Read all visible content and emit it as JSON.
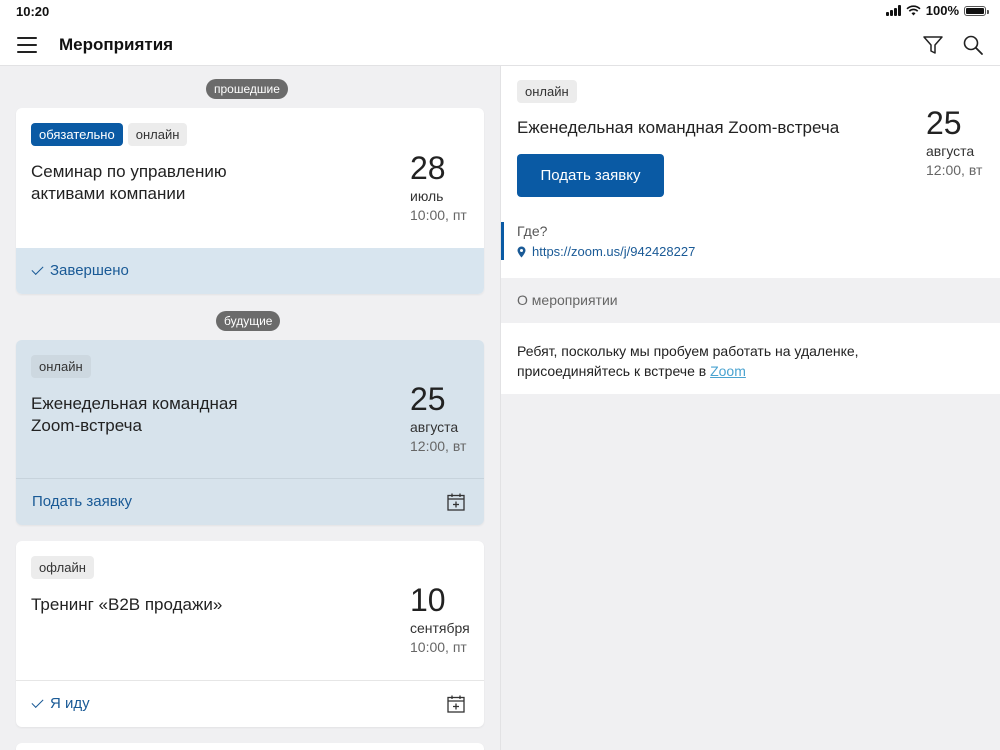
{
  "status_bar": {
    "time": "10:20",
    "battery": "100%"
  },
  "nav": {
    "title": "Мероприятия"
  },
  "list": {
    "past_label": "прошедшие",
    "future_label": "будущие",
    "events": [
      {
        "tags": [
          "обязательно",
          "онлайн"
        ],
        "title": "Семинар по управлению активами компании",
        "day": "28",
        "month": "июль",
        "time": "10:00, пт",
        "footer": "Завершено"
      },
      {
        "tags": [
          "онлайн"
        ],
        "title": "Еженедельная командная Zoom-встреча",
        "day": "25",
        "month": "августа",
        "time": "12:00, вт",
        "footer": "Подать заявку"
      },
      {
        "tags": [
          "офлайн"
        ],
        "title": "Тренинг «B2B продажи»",
        "day": "10",
        "month": "сентября",
        "time": "10:00, пт",
        "footer": "Я иду"
      }
    ]
  },
  "detail": {
    "tag": "онлайн",
    "title": "Еженедельная командная Zoom-встреча",
    "apply_label": "Подать заявку",
    "day": "25",
    "month": "августа",
    "time": "12:00, вт",
    "where_label": "Где?",
    "where_link": "https://zoom.us/j/942428227",
    "about_label": "О мероприятии",
    "about_text_1": "Ребят, поскольку мы пробуем работать на удаленке,",
    "about_text_2": "присоединяйтесь к встрече в ",
    "about_link": "Zoom"
  },
  "colors": {
    "accent": "#0a5aa4",
    "selected_card": "#d7e3ec",
    "background": "#f0f0f2"
  }
}
